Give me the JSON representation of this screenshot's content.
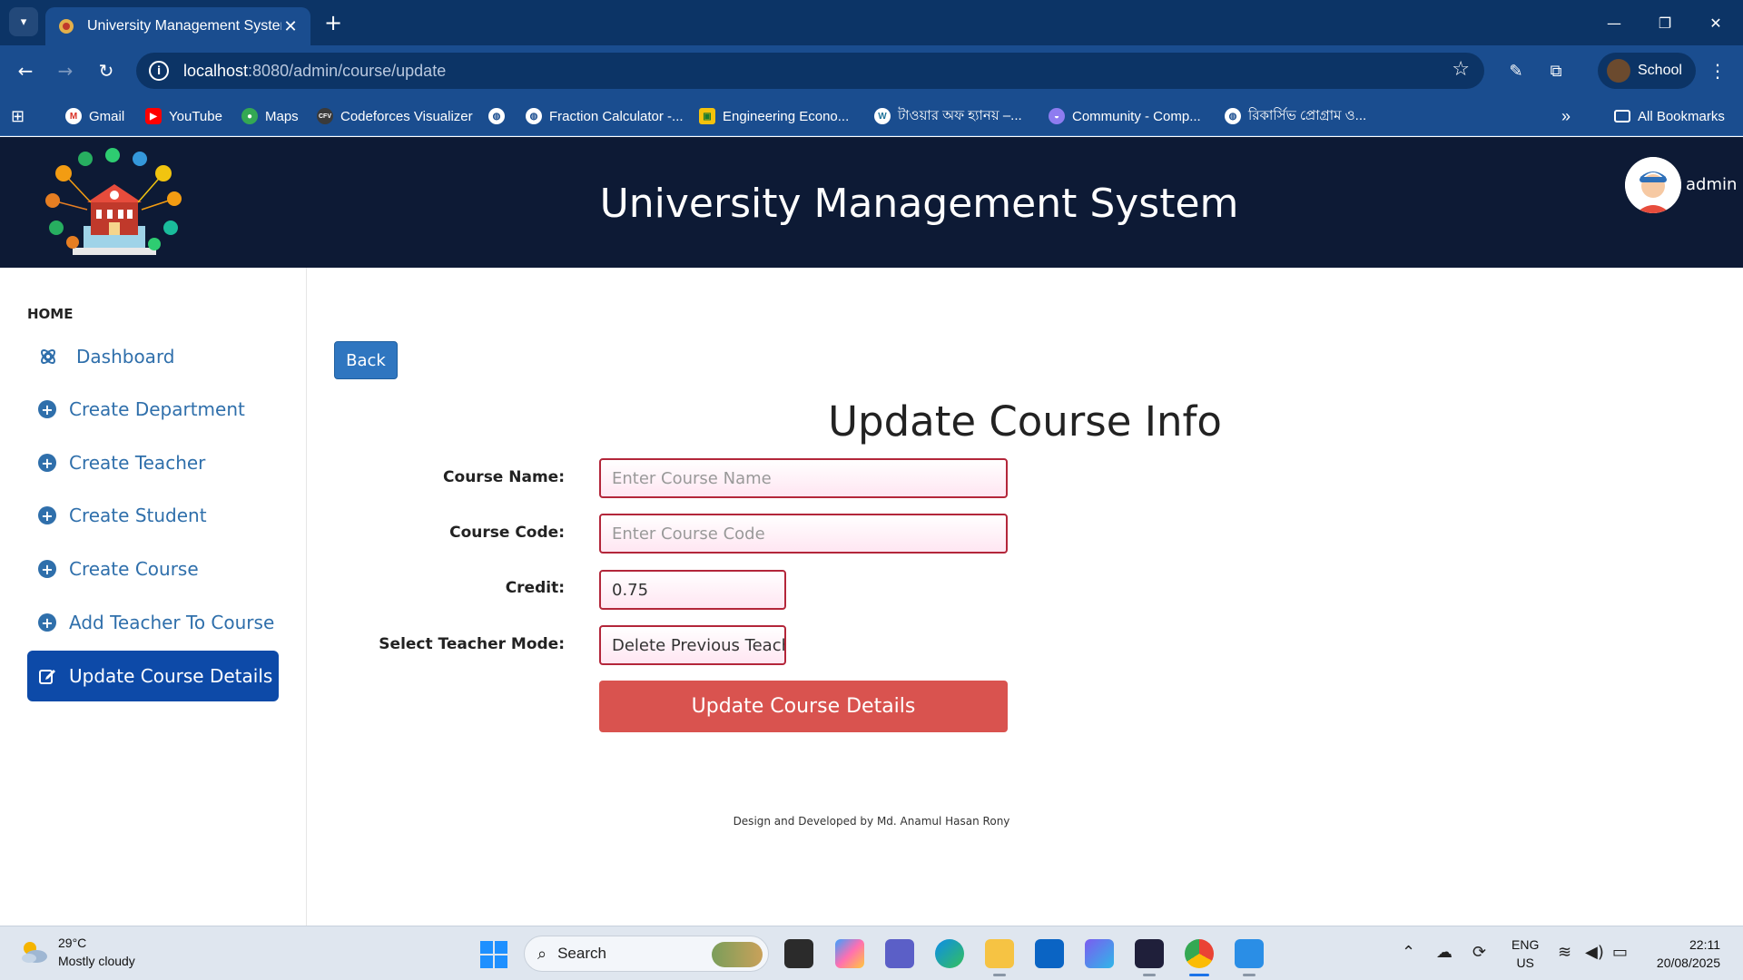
{
  "browser": {
    "tab_title": "University Management System",
    "url_host": "localhost",
    "url_rest": ":8080/admin/course/update",
    "profile_label": "School",
    "bookmarks": [
      {
        "label": "Gmail"
      },
      {
        "label": "YouTube"
      },
      {
        "label": "Maps"
      },
      {
        "label": "Codeforces Visualizer"
      },
      {
        "label": ""
      },
      {
        "label": "Fraction Calculator -..."
      },
      {
        "label": "Engineering Econo..."
      },
      {
        "label": "টাওয়ার অফ হ্যানয় –..."
      },
      {
        "label": "Community - Comp..."
      },
      {
        "label": "রিকার্সিভ প্রোগ্রাম ও..."
      }
    ],
    "all_bookmarks": "All Bookmarks"
  },
  "app": {
    "title": "University Management System",
    "user": "admin"
  },
  "sidebar": {
    "section_label": "HOME",
    "items": [
      {
        "label": "Dashboard"
      },
      {
        "label": "Create Department"
      },
      {
        "label": "Create Teacher"
      },
      {
        "label": "Create Student"
      },
      {
        "label": "Create Course"
      },
      {
        "label": "Add Teacher To Course"
      },
      {
        "label": "Update Course Details"
      }
    ]
  },
  "main": {
    "back_label": "Back",
    "form_title": "Update Course Info",
    "fields": {
      "course_name": {
        "label": "Course Name:",
        "placeholder": "Enter Course Name",
        "value": ""
      },
      "course_code": {
        "label": "Course Code:",
        "placeholder": "Enter Course Code",
        "value": ""
      },
      "credit": {
        "label": "Credit:",
        "value": "0.75"
      },
      "teacher_mode": {
        "label": "Select Teacher Mode:",
        "value": "Delete Previous Teache"
      }
    },
    "submit_label": "Update Course Details",
    "footer": "Design and Developed by Md. Anamul Hasan Rony"
  },
  "taskbar": {
    "weather_temp": "29°C",
    "weather_desc": "Mostly cloudy",
    "search_placeholder": "Search",
    "lang_line1": "ENG",
    "lang_line2": "US",
    "time": "22:11",
    "date": "20/08/2025"
  },
  "colors": {
    "header_bg": "#0d1a35",
    "sidebar_active": "#0d4aa8",
    "link_blue": "#2f6fab",
    "submit_red": "#d9534f",
    "input_border": "#b3263a"
  }
}
